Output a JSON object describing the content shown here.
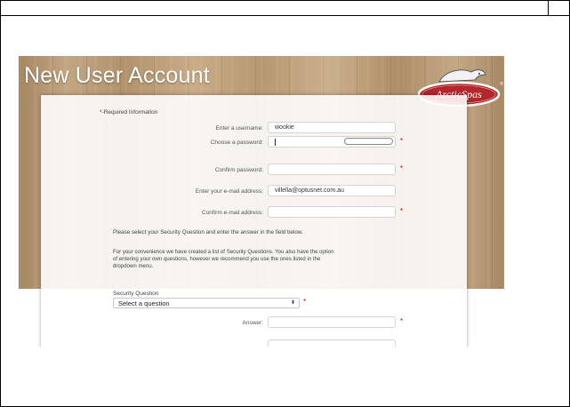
{
  "page": {
    "title": "New User Account",
    "logo_text": "ArcticSpas",
    "logo_trademark": "®"
  },
  "form": {
    "required_note_star": "*",
    "required_note": "-Required Information",
    "username_label": "Enter a username:",
    "username_value": "wookie",
    "password_label": "Choose a password:",
    "password_value": "",
    "confirm_password_label": "Confirm password:",
    "confirm_password_value": "",
    "email_label": "Enter your e-mail address:",
    "email_value": "villella@optusnet.com.au",
    "confirm_email_label": "Confirm e-mail address:",
    "confirm_email_value": "",
    "required_marker": "*",
    "security_instruction": "Please select your Security Question and enter the answer in the field below.",
    "security_note_line1": "For your convenience we have created a list of Security Questions. You also have the option",
    "security_note_line2": "of entering your own questions, however we recommend you use the ones listed in the",
    "security_note_line3": "dropdown menu.",
    "security_question_label": "Security Question",
    "security_question_selected": "Select a question",
    "select_arrow": "⬍",
    "answer_label": "Answer:",
    "answer_value": ""
  },
  "colors": {
    "required": "#cc0000",
    "title": "#ffffff",
    "logo_red": "#b3262a"
  }
}
